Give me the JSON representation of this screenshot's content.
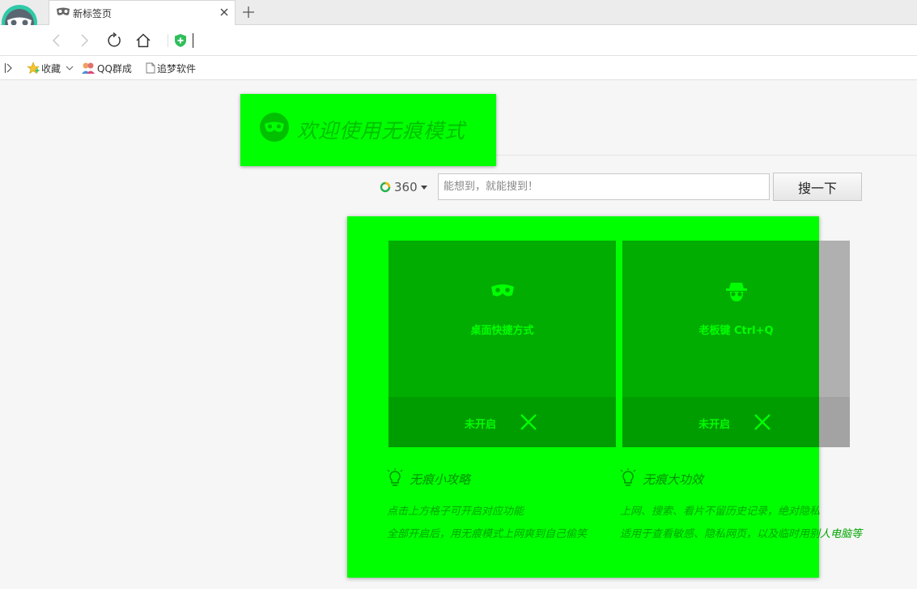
{
  "browser": {
    "tab": {
      "title": "新标签页"
    },
    "icons": {
      "logo": "browser-mask-logo-icon",
      "tab": "mask-icon",
      "close": "close-icon",
      "new_tab": "plus-icon",
      "back": "back-arrow-icon",
      "forward": "forward-arrow-icon",
      "reload": "reload-icon",
      "home": "home-icon",
      "security": "shield-plus-icon"
    }
  },
  "bookmarks": {
    "items": [
      {
        "label": "收藏",
        "icon": "star-icon"
      },
      {
        "label": "QQ群成",
        "icon": "people-icon"
      },
      {
        "label": "追梦软件",
        "icon": "page-icon"
      }
    ]
  },
  "page": {
    "banner": {
      "title": "欢迎使用无痕模式"
    },
    "search": {
      "engine": "360",
      "placeholder": "能想到，就能搜到！",
      "button": "搜一下"
    },
    "cards": [
      {
        "title": "桌面快捷方式",
        "status": "未开启",
        "icon": "mask-icon"
      },
      {
        "title": "老板键 Ctrl+Q",
        "status": "未开启",
        "icon": "spy-icon"
      }
    ],
    "tips": [
      {
        "title": "无痕小攻略",
        "lines": [
          "点击上方格子可开启对应功能",
          "全部开启后，用无痕模式上网爽到自己偷笑"
        ]
      },
      {
        "title": "无痕大功效",
        "lines": [
          "上网、搜索、看片不留历史记录，绝对隐私",
          "适用于查看敏感、隐私网页，以及临时用别人电脑等"
        ]
      }
    ]
  },
  "colors": {
    "highlight": "#00ff00",
    "card": "#00ad00",
    "card_footer": "#009d00",
    "text_green": "#00a600"
  }
}
